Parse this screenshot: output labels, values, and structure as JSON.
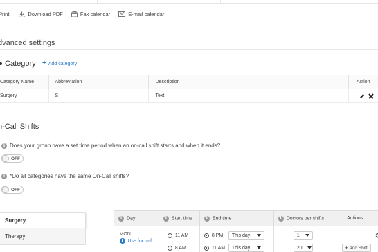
{
  "toolbar": {
    "print": "Print",
    "download_pdf": "Download PDF",
    "fax_calendar": "Fax calendar",
    "email_calendar": "E-mail calendar"
  },
  "advanced_settings": {
    "title": "dvanced settings"
  },
  "category": {
    "title": "Category",
    "add_label": "Add category",
    "columns": [
      "Category Name",
      "Abbreviation",
      "Description",
      "Action"
    ],
    "rows": [
      {
        "name": "Surgery",
        "abbreviation": "S",
        "description": "Text"
      }
    ]
  },
  "on_call": {
    "title": "n-Call Shifts",
    "q1": "Does your group have a set time period when an on-call shift starts and when it ends?",
    "q1_toggle": "OFF",
    "q2": "*Do all categories have the same On-Call shifts?",
    "q2_toggle": "OFF"
  },
  "sidebar": {
    "items": [
      {
        "label": "Surgery"
      },
      {
        "label": "Therapy"
      }
    ]
  },
  "shifts": {
    "columns": {
      "day": "Day",
      "start": "Start time",
      "end": "End time",
      "doctors": "Doctors per shifts",
      "actions": "Actions"
    },
    "row": {
      "day": "MON",
      "use_for": "Use for m-f",
      "start": "11 AM",
      "end": "8 PM",
      "end_day": "This day",
      "doctors": "1"
    },
    "row2": {
      "start": "8 AM",
      "end": "11 AM",
      "end_day": "This day",
      "doctors": "20",
      "add_shift": "Add Shift"
    }
  }
}
